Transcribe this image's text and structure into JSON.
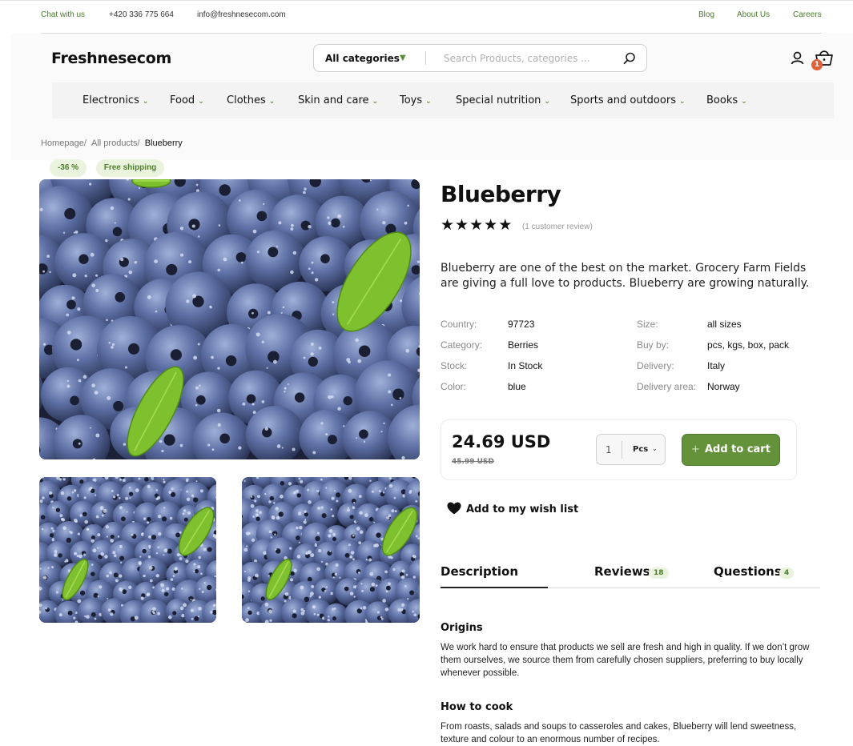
{
  "topbar": {
    "chat_label": "Chat with us",
    "phone": "+420 336 775 664",
    "email": "info@freshnesecom.com",
    "links": [
      "Blog",
      "About Us",
      "Careers"
    ]
  },
  "header": {
    "logo": "Freshnesecom",
    "search_category": "All categories",
    "search_placeholder": "Search Products, categories ...",
    "cart_count": "1"
  },
  "nav": {
    "items": [
      "Electronics",
      "Food",
      "Clothes",
      "Skin and care",
      "Toys",
      "Special nutrition",
      "Sports and outdoors",
      "Books"
    ]
  },
  "breadcrumb": {
    "items": [
      "Homepage",
      "All products"
    ],
    "separator": "/",
    "current": "Blueberry"
  },
  "badges": {
    "discount": "-36 %",
    "shipping": "Free shipping"
  },
  "product": {
    "title": "Blueberry",
    "rating": 5,
    "review_label": "(1 customer review)",
    "description": "Blueberry are one of the best on the market. Grocery Farm Fields are giving a full love to products. Blueberry are growing naturally.",
    "specs_left": [
      {
        "label": "Country:",
        "value": "97723"
      },
      {
        "label": "Category:",
        "value": "Berries"
      },
      {
        "label": "Stock:",
        "value": "In Stock"
      },
      {
        "label": "Color:",
        "value": "blue"
      }
    ],
    "specs_right": [
      {
        "label": "Size:",
        "value": "all sizes"
      },
      {
        "label": "Buy by:",
        "value": "pcs, kgs, box, pack"
      },
      {
        "label": "Delivery:",
        "value": "Italy"
      },
      {
        "label": "Delivery area:",
        "value": "Norway"
      }
    ],
    "price": "24.69 USD",
    "old_price": "45.99 USD",
    "quantity": "1",
    "unit": "Pcs",
    "add_to_cart": "Add to cart",
    "wishlist": "Add to my wish list"
  },
  "tabs": [
    {
      "label": "Description",
      "count": ""
    },
    {
      "label": "Reviews",
      "count": "18"
    },
    {
      "label": "Questions",
      "count": "4"
    }
  ],
  "sections": [
    {
      "title": "Origins",
      "body": "We work hard to ensure that products we sell are fresh and high in quality. If we don’t grow them ourselves, we source them from carefully chosen suppliers, preferring to buy locally whenever possible."
    },
    {
      "title": "How to cook",
      "body": "From roasts, salads and soups to casseroles and cakes, Blueberry will lend sweetness, texture and colour to an enormous number of recipes."
    }
  ],
  "colors": {
    "accent": "#64923a",
    "badge_bg": "#e9f3dd",
    "cart_badge": "#e0623a"
  }
}
